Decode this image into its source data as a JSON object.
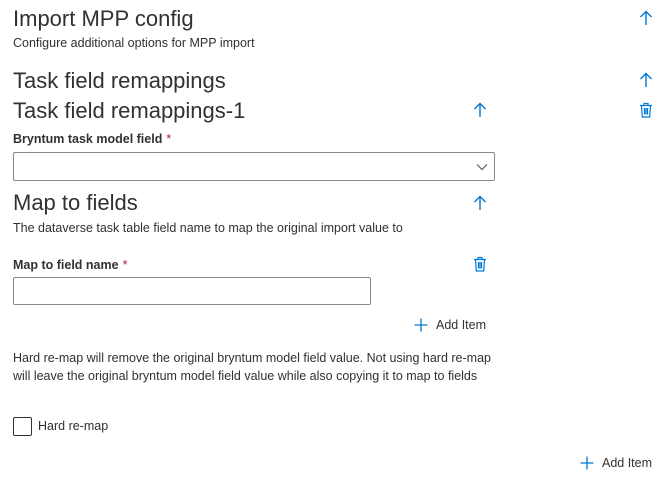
{
  "header": {
    "title": "Import MPP config",
    "subtitle": "Configure additional options for MPP import"
  },
  "task_field_remappings": {
    "title": "Task field remappings",
    "item": {
      "title": "Task field remappings-1",
      "bryntum_field_label": "Bryntum task model field",
      "required_mark": "*",
      "bryntum_field_value": ""
    },
    "map_to_fields": {
      "title": "Map to fields",
      "description": "The dataverse task table field name to map the original import value to",
      "field_name_label": "Map to field name",
      "required_mark": "*",
      "field_name_value": "",
      "add_item_label": "Add Item"
    },
    "hard_remap_description": "Hard re-map will remove the original bryntum model field value. Not using hard re-map will leave the original bryntum model field value while also copying it to map to fields",
    "hard_remap_label": "Hard re-map",
    "hard_remap_checked": false,
    "add_item_label": "Add Item"
  },
  "icons": {
    "collapse": "arrow-up-icon",
    "delete": "trash-icon",
    "add": "plus-icon",
    "dropdown": "chevron-down-icon"
  },
  "colors": {
    "accent": "#0078d4",
    "text": "#323130",
    "required": "#a4262c",
    "border": "#8a8886"
  }
}
